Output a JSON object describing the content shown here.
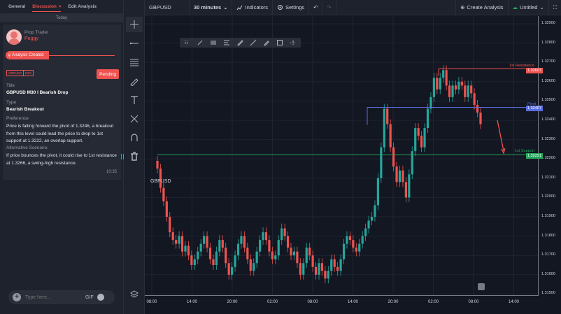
{
  "tabs": {
    "general": "General",
    "discussion": "Discussion",
    "discussion_close": "×",
    "edit_analysis": "Edit Analysis"
  },
  "today": "Today",
  "message": {
    "role": "Prop Trader",
    "name": "Peggy",
    "banner": "Analysis Created",
    "chips": [
      "GBPUSD",
      "M30"
    ],
    "status": "Pending",
    "title_label": "Title",
    "title_value": "GBPUSD M30 I Bearish Drop",
    "type_label": "Type",
    "type_value": "Bearish Breakout",
    "preference_label": "Preference:",
    "preference_text": "Price is falling forward the pivot of 1.3246, a breakout from this level could lead the price to drop to 1st support at 1.3222, an overlap support.",
    "alternative_label": "Alternative Scenario:",
    "alternative_text": "If price bounces the pivot, it could rise to 1st resistance at 1.3266, a swing-high resistance.",
    "time": "10:35"
  },
  "composer": {
    "placeholder": "Type here...",
    "gif": "GIF"
  },
  "topbar": {
    "symbol": "GBPUSD",
    "interval": "30 minutes",
    "indicators": "Indicators",
    "settings": "Settings",
    "create_analysis": "Create Analysis",
    "untitled": "Untitled"
  },
  "tools": [
    "crosshair-icon",
    "horizontal-line-icon",
    "fib-icon",
    "brush-icon",
    "text-icon",
    "pattern-icon",
    "magnet-icon",
    "trash-icon",
    "layers-icon"
  ],
  "chart_data": {
    "type": "candlestick",
    "symbol": "GBPUSD",
    "price_ticks": [
      "1.32900",
      "1.32800",
      "1.32700",
      "1.32600",
      "1.32500",
      "1.32400",
      "1.32300",
      "1.32200",
      "1.32100",
      "1.32000",
      "1.31900",
      "1.31800",
      "1.31700",
      "1.31600",
      "1.31500"
    ],
    "time_ticks": [
      "08:00",
      "14:00",
      "20:00",
      "02:00",
      "08:00",
      "14:00",
      "20:00",
      "02:00",
      "08:00",
      "14:00"
    ],
    "ylim": [
      1.315,
      1.3292
    ],
    "levels": [
      {
        "name": "1st Resistance",
        "price": 1.32667,
        "tag": "1.32667",
        "color": "#ef5350"
      },
      {
        "name": "Pivot",
        "price": 1.32467,
        "tag": "1.32467",
        "color": "#5b6ee1"
      },
      {
        "name": "1st Support",
        "price": 1.32221,
        "tag": "1.32221",
        "color": "#26a65b"
      }
    ],
    "close_path": [
      1.3215,
      1.3205,
      1.3198,
      1.319,
      1.3182,
      1.3178,
      1.3176,
      1.318,
      1.3172,
      1.3175,
      1.317,
      1.3165,
      1.3168,
      1.3172,
      1.3176,
      1.318,
      1.3174,
      1.3168,
      1.3165,
      1.3172,
      1.3178,
      1.3174,
      1.3166,
      1.316,
      1.3164,
      1.317,
      1.3176,
      1.318,
      1.3174,
      1.3168,
      1.3162,
      1.3166,
      1.3172,
      1.3178,
      1.3182,
      1.3178,
      1.3172,
      1.3168,
      1.317,
      1.3178,
      1.3184,
      1.318,
      1.3174,
      1.317,
      1.3172,
      1.3166,
      1.316,
      1.3166,
      1.3174,
      1.317,
      1.3164,
      1.316,
      1.3166,
      1.3162,
      1.3158,
      1.3162,
      1.3168,
      1.3164,
      1.3162,
      1.3168,
      1.3176,
      1.318,
      1.3178,
      1.3174,
      1.3172,
      1.3176,
      1.318,
      1.3184,
      1.3188,
      1.319,
      1.3196,
      1.321,
      1.3226,
      1.3246,
      1.3238,
      1.3226,
      1.3216,
      1.3208,
      1.3214,
      1.3208,
      1.32,
      1.3212,
      1.3224,
      1.3236,
      1.3232,
      1.3226,
      1.3236,
      1.3246,
      1.3252,
      1.3262,
      1.3256,
      1.3262,
      1.3266,
      1.3258,
      1.3252,
      1.3258,
      1.3256,
      1.326,
      1.3258,
      1.3252,
      1.3258,
      1.3254,
      1.3248,
      1.3244,
      1.3238
    ],
    "arrow": {
      "from": [
        1.324
      ],
      "to": [
        1.3223
      ]
    }
  }
}
